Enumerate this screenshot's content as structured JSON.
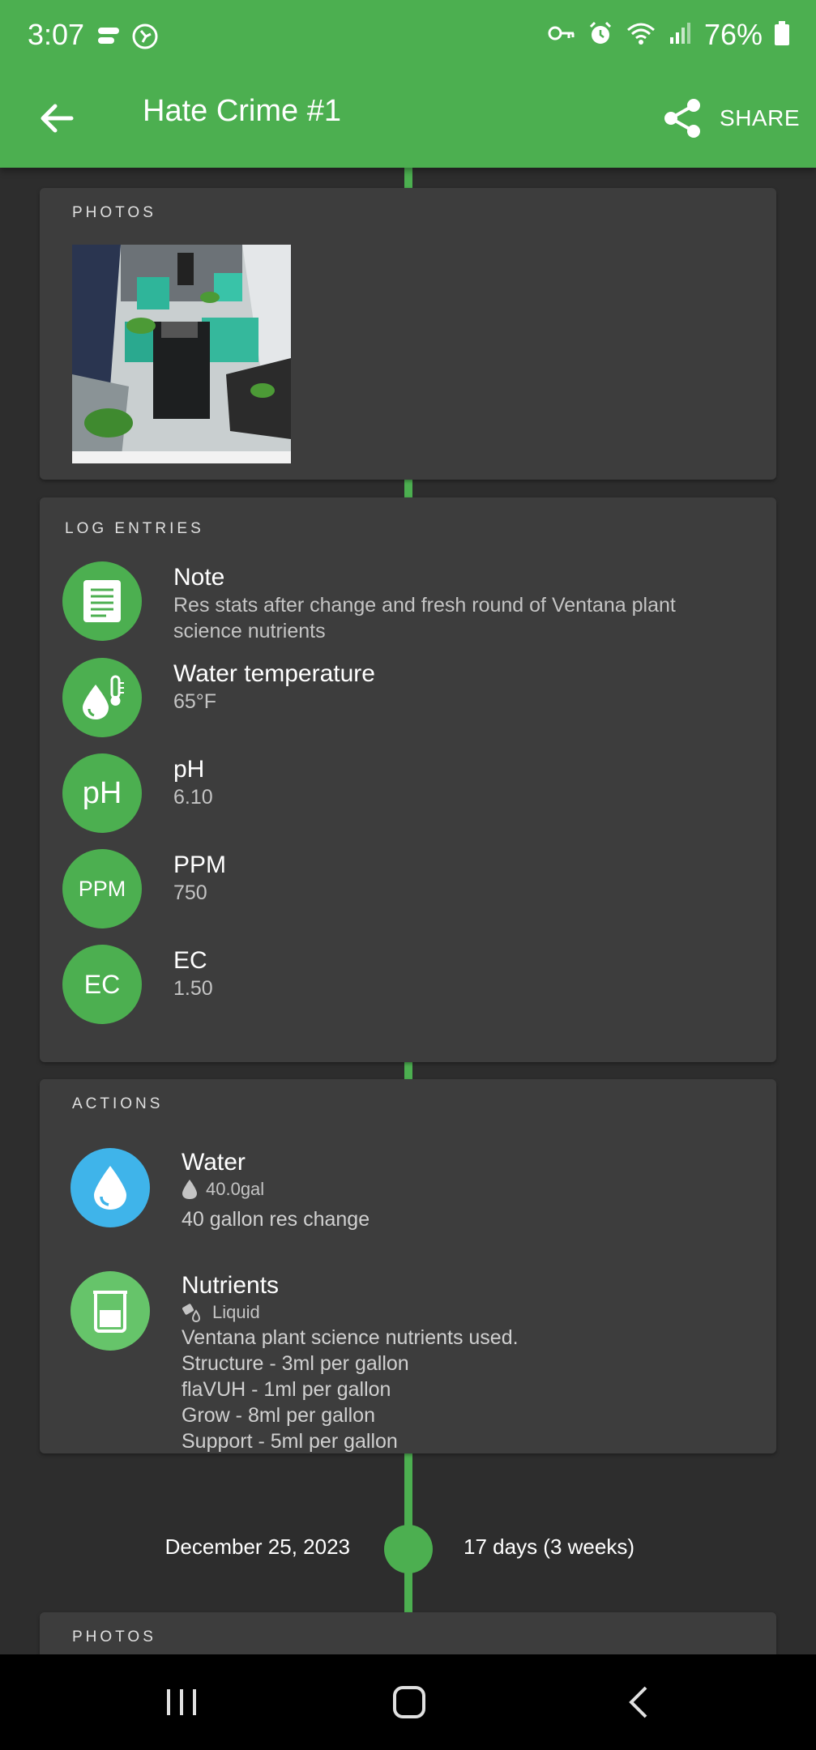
{
  "status_bar": {
    "time": "3:07",
    "battery_percent": "76%"
  },
  "toolbar": {
    "title": "Hate Crime #1",
    "share_label": "SHARE"
  },
  "photos_section": {
    "header": "PHOTOS"
  },
  "log_entries": {
    "header": "LOG ENTRIES",
    "items": [
      {
        "title": "Note",
        "value": "Res stats after change and fresh round of Ventana plant science nutrients",
        "icon": "note-icon"
      },
      {
        "title": "Water temperature",
        "value": "65°F",
        "icon": "water-temperature-icon"
      },
      {
        "title": "pH",
        "value": "6.10",
        "icon_text": "pH"
      },
      {
        "title": "PPM",
        "value": "750",
        "icon_text": "PPM"
      },
      {
        "title": "EC",
        "value": "1.50",
        "icon_text": "EC"
      }
    ]
  },
  "actions": {
    "header": "ACTIONS",
    "items": [
      {
        "title": "Water",
        "sub": "40.0gal",
        "description": "40 gallon res change",
        "icon": "water-drop-icon",
        "color": "#3fb4ea"
      },
      {
        "title": "Nutrients",
        "sub": "Liquid",
        "description": "Ventana plant science nutrients used.\nStructure - 3ml per gallon\nflaVUH - 1ml per gallon\nGrow - 8ml per gallon\nSupport - 5ml per gallon",
        "icon": "beaker-icon",
        "color": "#66c46a"
      }
    ]
  },
  "timeline_marker": {
    "date": "December 25, 2023",
    "age": "17 days (3 weeks)"
  },
  "next_section": {
    "header": "PHOTOS"
  },
  "colors": {
    "accent": "#4caf50",
    "card": "#3d3d3d",
    "background": "#2d2d2d"
  }
}
